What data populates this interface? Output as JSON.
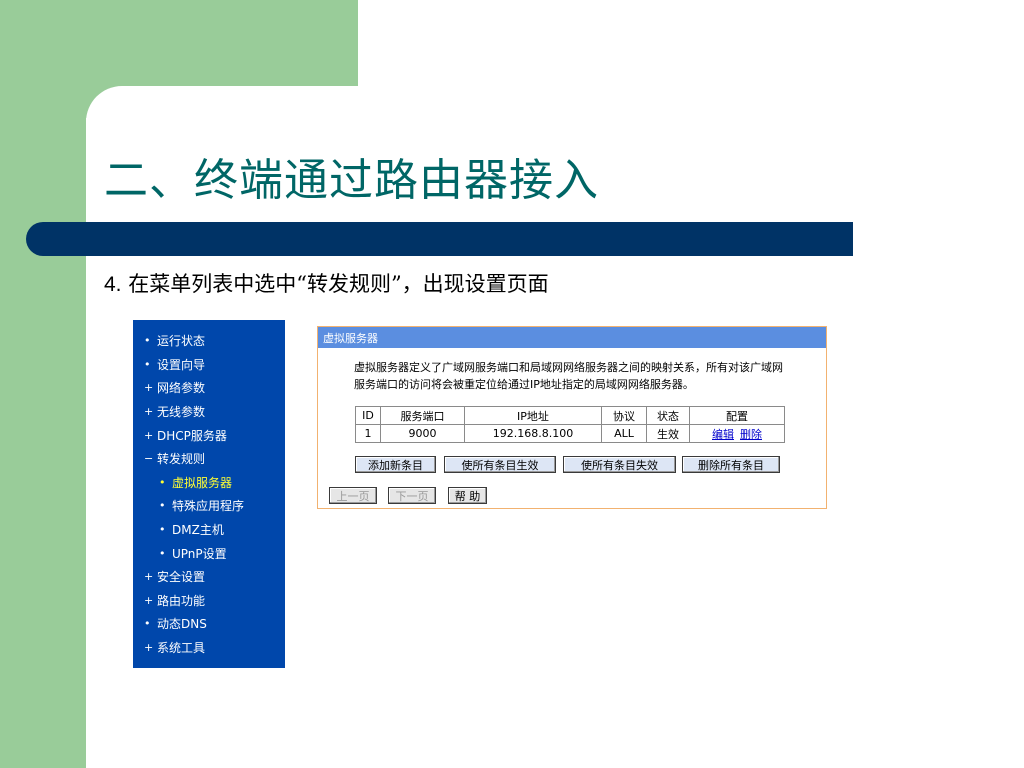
{
  "slide": {
    "title": "二、终端通过路由器接入",
    "step_number": "4.",
    "step_text": "在菜单列表中选中“转发规则”，出现设置页面"
  },
  "menu": {
    "items": [
      {
        "mark": "•",
        "label": "运行状态"
      },
      {
        "mark": "•",
        "label": "设置向导"
      },
      {
        "mark": "+",
        "label": "网络参数"
      },
      {
        "mark": "+",
        "label": "无线参数"
      },
      {
        "mark": "+",
        "label": "DHCP服务器"
      },
      {
        "mark": "−",
        "label": "转发规则"
      },
      {
        "mark": "•",
        "label": "虚拟服务器"
      },
      {
        "mark": "•",
        "label": "特殊应用程序"
      },
      {
        "mark": "•",
        "label": "DMZ主机"
      },
      {
        "mark": "•",
        "label": "UPnP设置"
      },
      {
        "mark": "+",
        "label": "安全设置"
      },
      {
        "mark": "+",
        "label": "路由功能"
      },
      {
        "mark": "•",
        "label": "动态DNS"
      },
      {
        "mark": "+",
        "label": "系统工具"
      }
    ]
  },
  "panel": {
    "header": "虚拟服务器",
    "description_line1": "虚拟服务器定义了广域网服务端口和局域网网络服务器之间的映射关系，所有对该广域网",
    "description_line2": "服务端口的访问将会被重定位给通过IP地址指定的局域网网络服务器。",
    "table": {
      "headers": [
        "ID",
        "服务端口",
        "IP地址",
        "协议",
        "状态",
        "配置"
      ],
      "row": {
        "id": "1",
        "port": "9000",
        "ip": "192.168.8.100",
        "protocol": "ALL",
        "status": "生效",
        "edit": "编辑",
        "delete": "删除"
      }
    },
    "buttons": {
      "add": "添加新条目",
      "enable_all": "使所有条目生效",
      "disable_all": "使所有条目失效",
      "delete_all": "删除所有条目"
    },
    "nav": {
      "prev": "上一页",
      "next": "下一页",
      "help": "帮 助"
    }
  },
  "colors": {
    "slide_green": "#99cc99",
    "title_bar": "#003366",
    "title_text": "#006666",
    "menu_bg": "#0047ab",
    "menu_active": "#ffff33",
    "panel_header": "#5b8ee0",
    "panel_border": "#f2b270"
  }
}
